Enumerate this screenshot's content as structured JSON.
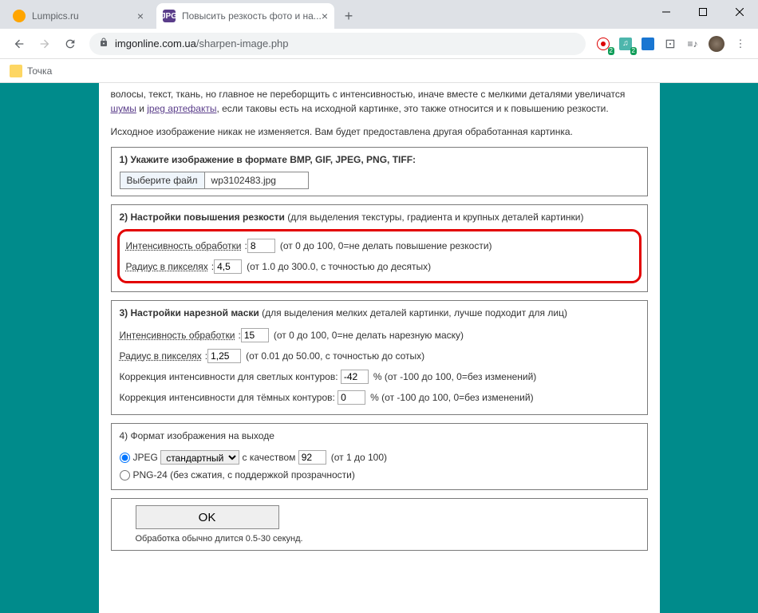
{
  "browser": {
    "tabs": [
      {
        "title": "Lumpics.ru"
      },
      {
        "title": "Повысить резкость фото и на..."
      }
    ],
    "url_host": "imgonline.com.ua",
    "url_path": "/sharpen-image.php",
    "bookmarks": {
      "tochka": "Точка"
    }
  },
  "ext": {
    "badge1": "2",
    "badge2": "2"
  },
  "intro": {
    "partial": "волосы, текст, ткань, но главное не переборщить с интенсивностью, иначе вместе с мелкими деталями увеличатся ",
    "link1": "шумы",
    "and": " и ",
    "link2": "jpeg артефакты",
    "tail": ", если таковы есть на исходной картинке, это также относится и к повышению резкости.",
    "note": "Исходное изображение никак не изменяется. Вам будет предоставлена другая обработанная картинка."
  },
  "step1": {
    "title": "1) Укажите изображение в формате BMP, GIF, JPEG, PNG, TIFF:",
    "button": "Выберите файл",
    "filename": "wp3102483.jpg"
  },
  "step2": {
    "title_main": "2) Настройки повышения резкости",
    "title_sub": " (для выделения текстуры, градиента и крупных деталей картинки)",
    "intensity_label": "Интенсивность обработки",
    "intensity_value": "8",
    "intensity_hint": "(от 0 до 100, 0=не делать повышение резкости)",
    "radius_label": "Радиус в пикселях",
    "radius_value": "4,5",
    "radius_hint": "(от 1.0 до 300.0, с точностью до десятых)"
  },
  "step3": {
    "title_main": "3) Настройки нарезной маски",
    "title_sub": " (для выделения мелких деталей картинки, лучше подходит для лиц)",
    "intensity_label": "Интенсивность обработки",
    "intensity_value": "15",
    "intensity_hint": "(от 0 до 100, 0=не делать нарезную маску)",
    "radius_label": "Радиус в пикселях",
    "radius_value": "1,25",
    "radius_hint": "(от 0.01 до 50.00, с точностью до сотых)",
    "light_label": "Коррекция интенсивности для светлых контуров:",
    "light_value": "-42",
    "light_hint": "% (от -100 до 100, 0=без изменений)",
    "dark_label": "Коррекция интенсивности для тёмных контуров:",
    "dark_value": "0",
    "dark_hint": "% (от -100 до 100, 0=без изменений)"
  },
  "step4": {
    "title": "4) Формат изображения на выходе",
    "jpeg_label": "JPEG",
    "jpeg_option": "стандартный",
    "jpeg_qual_label": "с качеством",
    "jpeg_qual_value": "92",
    "jpeg_qual_hint": "(от 1 до 100)",
    "png_label": "PNG-24 (без сжатия, с поддержкой прозрачности)"
  },
  "submit": {
    "button": "OK",
    "note": "Обработка обычно длится 0.5-30 секунд."
  }
}
